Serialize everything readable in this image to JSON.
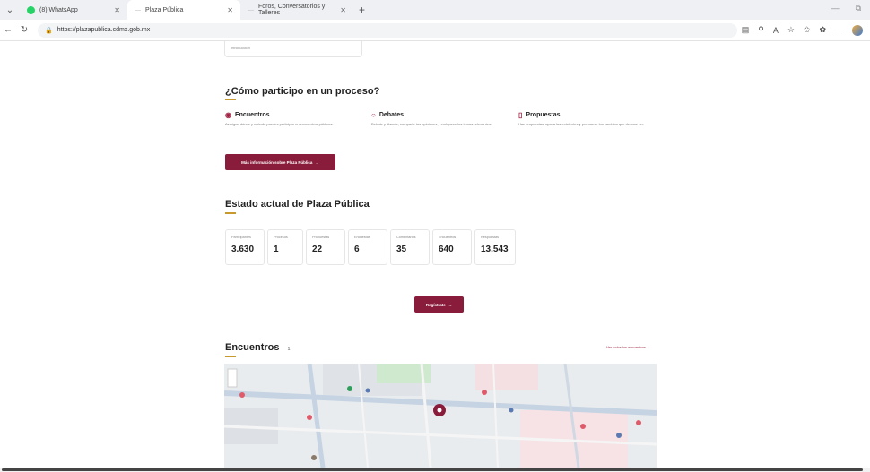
{
  "tabs": [
    {
      "label": "(8) WhatsApp",
      "active": false
    },
    {
      "label": "Plaza Pública",
      "active": true
    },
    {
      "label": "Foros, Conversatorios y Talleres",
      "active": false
    }
  ],
  "address": {
    "url": "https://plazapublica.cdmx.gob.mx"
  },
  "page": {
    "prev_card_text": "Introducción",
    "participate_title": "¿Cómo participo en un proceso?",
    "processes": [
      {
        "title": "Encuentros",
        "icon": "pin-icon",
        "desc": "Averigua dónde y cuándo puedes participar en encuentros públicos."
      },
      {
        "title": "Debates",
        "icon": "chat-icon",
        "desc": "Debate y discute, comparte tus opiniones y enriquece los temas relevantes."
      },
      {
        "title": "Propuestas",
        "icon": "document-icon",
        "desc": "Haz propuestas, apoya las existentes y promueve los cambios que deseas ver."
      }
    ],
    "more_info_label": "Más información sobre Plaza Pública",
    "status_title": "Estado actual de Plaza Pública",
    "stats": [
      {
        "label": "Participantes",
        "value": "3.630"
      },
      {
        "label": "Procesos",
        "value": "1"
      },
      {
        "label": "Propuestas",
        "value": "22"
      },
      {
        "label": "Encuestas",
        "value": "6"
      },
      {
        "label": "Comentarios",
        "value": "35"
      },
      {
        "label": "Encuentros",
        "value": "640"
      },
      {
        "label": "Respuestas",
        "value": "13.543"
      }
    ],
    "register_label": "Regístrate",
    "meetings_title": "Encuentros",
    "meetings_count": "1",
    "see_all_label": "Ver todos los encuentros"
  },
  "colors": {
    "accent": "#8a1c3b",
    "underline": "#c89a2e"
  }
}
